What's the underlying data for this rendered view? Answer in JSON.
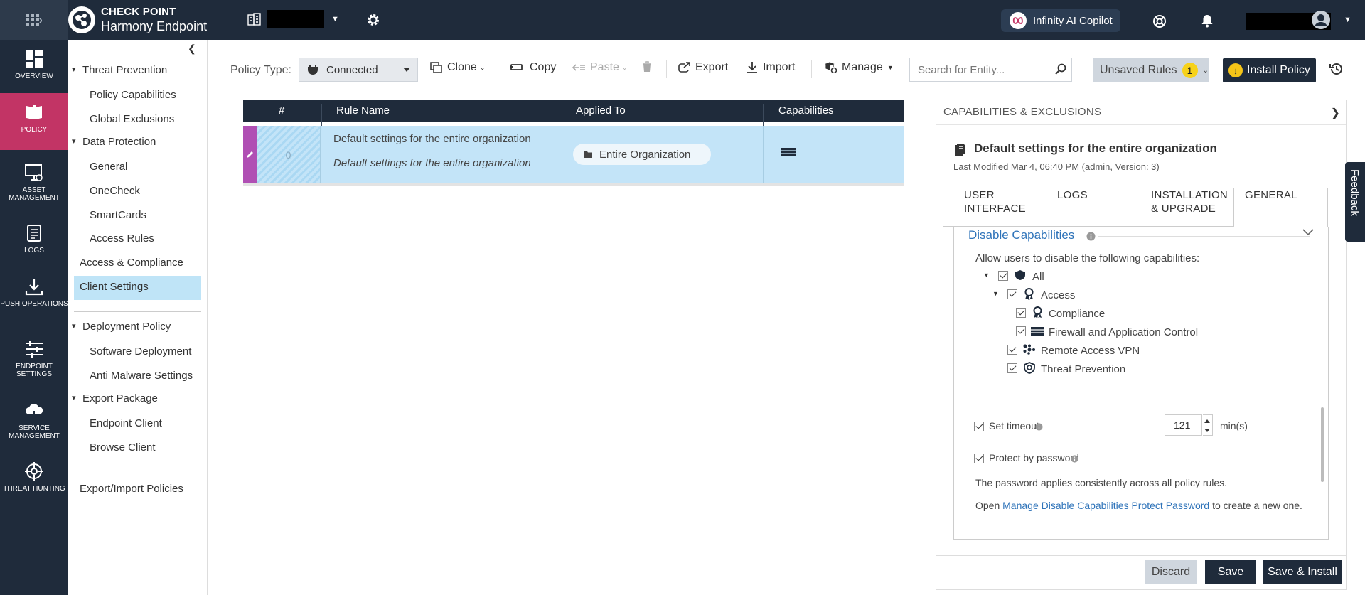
{
  "header": {
    "brand_line1": "CHECK POINT",
    "brand_line2": "Harmony Endpoint",
    "copilot_label": "Infinity AI Copilot"
  },
  "leftnav": [
    {
      "label": "OVERVIEW",
      "icon": "dashboard-icon"
    },
    {
      "label": "POLICY",
      "icon": "policy-book-icon",
      "active": true
    },
    {
      "label": "ASSET MANAGEMENT",
      "icon": "monitor-icon"
    },
    {
      "label": "LOGS",
      "icon": "logs-icon"
    },
    {
      "label": "PUSH OPERATIONS",
      "icon": "download-icon"
    },
    {
      "label": "ENDPOINT SETTINGS",
      "icon": "sliders-icon"
    },
    {
      "label": "SERVICE MANAGEMENT",
      "icon": "cloud-icon"
    },
    {
      "label": "THREAT HUNTING",
      "icon": "crosshair-icon"
    }
  ],
  "tree": {
    "threat_prevention": "Threat Prevention",
    "policy_capabilities": "Policy Capabilities",
    "global_exclusions": "Global Exclusions",
    "data_protection": "Data Protection",
    "general": "General",
    "onecheck": "OneCheck",
    "smartcards": "SmartCards",
    "access_rules": "Access Rules",
    "access_compliance": "Access & Compliance",
    "client_settings": "Client Settings",
    "deployment_policy": "Deployment Policy",
    "software_deployment": "Software Deployment",
    "anti_malware": "Anti Malware Settings",
    "export_package": "Export Package",
    "endpoint_client": "Endpoint Client",
    "browse_client": "Browse Client",
    "export_import": "Export/Import Policies"
  },
  "toolbar": {
    "policy_type_label": "Policy Type:",
    "policy_type_value": "Connected",
    "clone": "Clone",
    "copy": "Copy",
    "paste": "Paste",
    "export": "Export",
    "import": "Import",
    "manage": "Manage",
    "search_placeholder": "Search for Entity...",
    "unsaved_label": "Unsaved Rules",
    "unsaved_count": "1",
    "install_label": "Install Policy"
  },
  "table": {
    "columns": [
      "#",
      "Rule Name",
      "Applied To",
      "Capabilities"
    ],
    "rows": [
      {
        "num": "0",
        "name": "Default settings for the entire organization",
        "comment": "Default settings for the entire organization",
        "applied_to": "Entire Organization"
      }
    ]
  },
  "panel": {
    "header": "CAPABILITIES & EXCLUSIONS",
    "title": "Default settings for the entire organization",
    "modified": "Last Modified Mar 4, 06:40 PM (admin, Version: 3)",
    "tabs": [
      {
        "line1": "USER",
        "line2": "INTERFACE"
      },
      {
        "line1": "LOGS",
        "line2": ""
      },
      {
        "line1": "INSTALLATION",
        "line2": "& UPGRADE"
      },
      {
        "line1": "GENERAL",
        "line2": "",
        "active": true
      }
    ],
    "section_title": "Disable Capabilities",
    "allow_text": "Allow users to disable the following capabilities:",
    "tree_items": [
      "All",
      "Access",
      "Compliance",
      "Firewall and Application Control",
      "Remote Access VPN",
      "Threat Prevention"
    ],
    "timeout_label": "Set timeout",
    "timeout_value": "121",
    "timeout_unit": "min(s)",
    "password_label": "Protect by password",
    "password_note": "The password applies consistently across all policy rules.",
    "open_prefix": "Open ",
    "open_link": "Manage Disable Capabilities Protect Password",
    "open_suffix": " to create a new one.",
    "discard": "Discard",
    "save": "Save",
    "save_install": "Save & Install"
  },
  "feedback": "Feedback",
  "colors": {
    "nav_bg": "#1f2b3b",
    "active_nav": "#c23465",
    "link": "#2e73b9",
    "row_selected": "#c3e4f8",
    "badge": "#f7d21a"
  }
}
